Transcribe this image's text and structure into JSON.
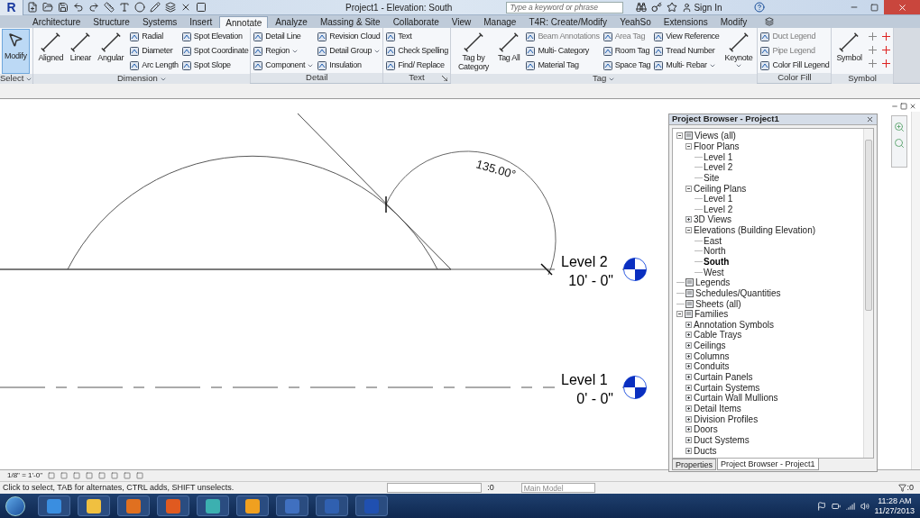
{
  "title_bar": {
    "app_button": "R",
    "title": "Project1 - Elevation: South",
    "search": {
      "placeholder": "Type a keyword or phrase"
    },
    "sign_in": "Sign In"
  },
  "ribbon_tabs": [
    {
      "label": "Architecture",
      "selected": false
    },
    {
      "label": "Structure",
      "selected": false
    },
    {
      "label": "Systems",
      "selected": false
    },
    {
      "label": "Insert",
      "selected": false
    },
    {
      "label": "Annotate",
      "selected": true
    },
    {
      "label": "Analyze",
      "selected": false
    },
    {
      "label": "Massing & Site",
      "selected": false
    },
    {
      "label": "Collaborate",
      "selected": false
    },
    {
      "label": "View",
      "selected": false
    },
    {
      "label": "Manage",
      "selected": false
    },
    {
      "label": "T4R: Create/Modify",
      "selected": false
    },
    {
      "label": "YeahSo",
      "selected": false
    },
    {
      "label": "Extensions",
      "selected": false
    },
    {
      "label": "Modify",
      "selected": false
    }
  ],
  "ribbon_panels": [
    {
      "title": "Select",
      "menu": true,
      "launcher": false,
      "items": [
        {
          "kind": "large",
          "tools": [
            {
              "label": "Modify",
              "selected": true,
              "dropdown": false
            }
          ]
        }
      ]
    },
    {
      "title": "Dimension",
      "menu": true,
      "launcher": false,
      "items": [
        {
          "kind": "large",
          "tools": [
            {
              "label": "Aligned",
              "selected": false,
              "dropdown": false
            },
            {
              "label": "Linear",
              "selected": false,
              "dropdown": false
            },
            {
              "label": "Angular",
              "selected": false,
              "dropdown": false
            }
          ]
        },
        {
          "kind": "column",
          "tools": [
            {
              "label": "Radial",
              "disabled": false,
              "dropdown": false
            },
            {
              "label": "Diameter",
              "disabled": false,
              "dropdown": false
            },
            {
              "label": "Arc Length",
              "disabled": false,
              "dropdown": false
            }
          ]
        },
        {
          "kind": "column",
          "tools": [
            {
              "label": "Spot Elevation",
              "disabled": false,
              "dropdown": false
            },
            {
              "label": "Spot Coordinate",
              "disabled": false,
              "dropdown": false
            },
            {
              "label": "Spot Slope",
              "disabled": false,
              "dropdown": false
            }
          ]
        }
      ]
    },
    {
      "title": "Detail",
      "menu": false,
      "launcher": false,
      "items": [
        {
          "kind": "column",
          "tools": [
            {
              "label": "Detail Line",
              "disabled": false,
              "dropdown": false
            },
            {
              "label": "Region",
              "disabled": false,
              "dropdown": true
            },
            {
              "label": "Component",
              "disabled": false,
              "dropdown": true
            }
          ]
        },
        {
          "kind": "column",
          "tools": [
            {
              "label": "Revision Cloud",
              "disabled": false,
              "dropdown": false
            },
            {
              "label": "Detail Group",
              "disabled": false,
              "dropdown": true
            },
            {
              "label": "Insulation",
              "disabled": false,
              "dropdown": false
            }
          ]
        }
      ]
    },
    {
      "title": "Text",
      "menu": false,
      "launcher": true,
      "items": [
        {
          "kind": "column",
          "tools": [
            {
              "label": "Text",
              "disabled": false,
              "dropdown": false
            },
            {
              "label": "Check Spelling",
              "disabled": false,
              "dropdown": false
            },
            {
              "label": "Find/ Replace",
              "disabled": false,
              "dropdown": false
            }
          ]
        }
      ]
    },
    {
      "title": "Tag",
      "menu": true,
      "launcher": false,
      "items": [
        {
          "kind": "large",
          "tools": [
            {
              "label": "Tag by Category",
              "selected": false,
              "dropdown": false
            },
            {
              "label": "Tag All",
              "selected": false,
              "dropdown": false
            }
          ]
        },
        {
          "kind": "column",
          "tools": [
            {
              "label": "Beam Annotations",
              "disabled": true,
              "dropdown": false
            },
            {
              "label": "Multi- Category",
              "disabled": false,
              "dropdown": false
            },
            {
              "label": "Material Tag",
              "disabled": false,
              "dropdown": false
            }
          ]
        },
        {
          "kind": "column",
          "tools": [
            {
              "label": "Area Tag",
              "disabled": true,
              "dropdown": false
            },
            {
              "label": "Room Tag",
              "disabled": false,
              "dropdown": false
            },
            {
              "label": "Space Tag",
              "disabled": false,
              "dropdown": false
            }
          ]
        },
        {
          "kind": "column",
          "tools": [
            {
              "label": "View Reference",
              "disabled": false,
              "dropdown": false
            },
            {
              "label": "Tread Number",
              "disabled": false,
              "dropdown": false
            },
            {
              "label": "Multi- Rebar",
              "disabled": false,
              "dropdown": true
            }
          ]
        },
        {
          "kind": "large",
          "tools": [
            {
              "label": "Keynote",
              "selected": false,
              "dropdown": true
            }
          ]
        }
      ]
    },
    {
      "title": "Color Fill",
      "menu": false,
      "launcher": false,
      "items": [
        {
          "kind": "column",
          "tools": [
            {
              "label": "Duct Legend",
              "disabled": true,
              "dropdown": false
            },
            {
              "label": "Pipe Legend",
              "disabled": true,
              "dropdown": false
            },
            {
              "label": "Color Fill Legend",
              "disabled": false,
              "dropdown": false
            }
          ]
        }
      ]
    },
    {
      "title": "Symbol",
      "menu": false,
      "launcher": false,
      "items": [
        {
          "kind": "large",
          "tools": [
            {
              "label": "Symbol",
              "selected": false,
              "dropdown": false
            }
          ]
        },
        {
          "kind": "icons"
        }
      ]
    }
  ],
  "drawing": {
    "angle_label": "135.00°",
    "levels": [
      {
        "name": "Level 2",
        "elevation": "10' - 0\""
      },
      {
        "name": "Level 1",
        "elevation": "0' - 0\""
      }
    ]
  },
  "project_browser": {
    "title": "Project Browser - Project1",
    "tree": [
      {
        "label": "Views (all)",
        "expanded": true,
        "selected": false,
        "children": [
          {
            "label": "Floor Plans",
            "expanded": true,
            "selected": false,
            "children": [
              {
                "label": "Level 1",
                "selected": false
              },
              {
                "label": "Level 2",
                "selected": false
              },
              {
                "label": "Site",
                "selected": false
              }
            ]
          },
          {
            "label": "Ceiling Plans",
            "expanded": true,
            "selected": false,
            "children": [
              {
                "label": "Level 1",
                "selected": false
              },
              {
                "label": "Level 2",
                "selected": false
              }
            ]
          },
          {
            "label": "3D Views",
            "expanded": false,
            "selected": false
          },
          {
            "label": "Elevations (Building Elevation)",
            "expanded": true,
            "selected": false,
            "children": [
              {
                "label": "East",
                "selected": false
              },
              {
                "label": "North",
                "selected": false
              },
              {
                "label": "South",
                "selected": true
              },
              {
                "label": "West",
                "selected": false
              }
            ]
          }
        ]
      },
      {
        "label": "Legends",
        "selected": false
      },
      {
        "label": "Schedules/Quantities",
        "selected": false
      },
      {
        "label": "Sheets (all)",
        "selected": false
      },
      {
        "label": "Families",
        "expanded": true,
        "selected": false,
        "children": [
          {
            "label": "Annotation Symbols",
            "expanded": false,
            "selected": false
          },
          {
            "label": "Cable Trays",
            "expanded": false,
            "selected": false
          },
          {
            "label": "Ceilings",
            "expanded": false,
            "selected": false
          },
          {
            "label": "Columns",
            "expanded": false,
            "selected": false
          },
          {
            "label": "Conduits",
            "expanded": false,
            "selected": false
          },
          {
            "label": "Curtain Panels",
            "expanded": false,
            "selected": false
          },
          {
            "label": "Curtain Systems",
            "expanded": false,
            "selected": false
          },
          {
            "label": "Curtain Wall Mullions",
            "expanded": false,
            "selected": false
          },
          {
            "label": "Detail Items",
            "expanded": false,
            "selected": false
          },
          {
            "label": "Division Profiles",
            "expanded": false,
            "selected": false
          },
          {
            "label": "Doors",
            "expanded": false,
            "selected": false
          },
          {
            "label": "Duct Systems",
            "expanded": false,
            "selected": false
          },
          {
            "label": "Ducts",
            "expanded": false,
            "selected": false
          }
        ]
      }
    ],
    "tabs": [
      {
        "label": "Properties",
        "selected": false
      },
      {
        "label": "Project Browser - Project1",
        "selected": true
      }
    ]
  },
  "view_control_bar": {
    "scale": "1/8\" = 1'-0\""
  },
  "status_bar": {
    "message": "Click to select, TAB for alternates, CTRL adds, SHIFT unselects.",
    "workset_count": ":0",
    "model": "Main Model",
    "filter_count": ":0"
  },
  "taskbar": {
    "time": "11:28 AM",
    "date": "11/27/2013"
  }
}
